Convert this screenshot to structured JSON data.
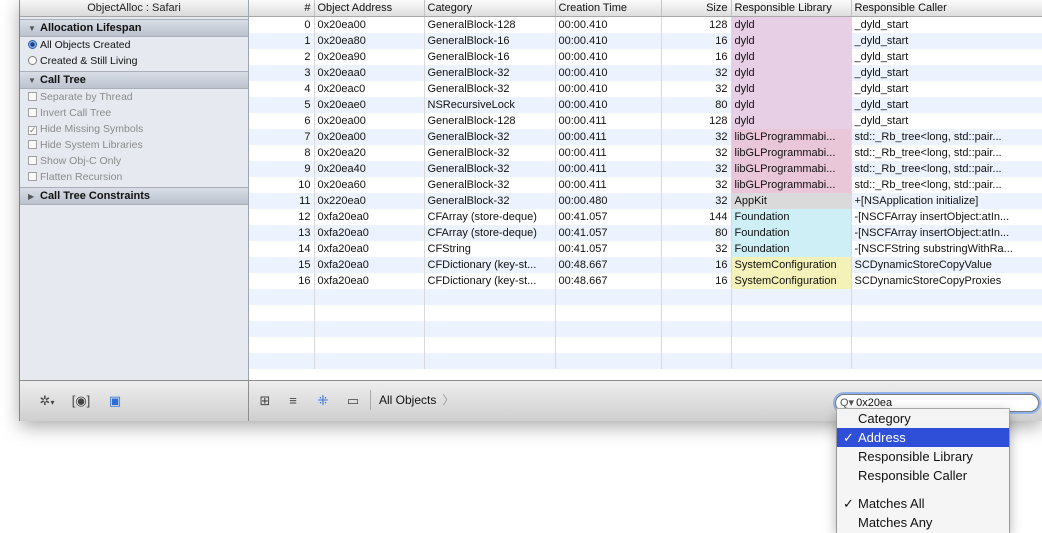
{
  "sidebar": {
    "title": "ObjectAlloc : Safari",
    "allocation": {
      "heading": "Allocation Lifespan",
      "options": [
        {
          "label": "All Objects Created",
          "selected": true
        },
        {
          "label": "Created & Still Living",
          "selected": false
        }
      ]
    },
    "calltree": {
      "heading": "Call Tree",
      "options": [
        {
          "label": "Separate by Thread",
          "checked": false
        },
        {
          "label": "Invert Call Tree",
          "checked": false
        },
        {
          "label": "Hide Missing Symbols",
          "checked": true
        },
        {
          "label": "Hide System Libraries",
          "checked": false
        },
        {
          "label": "Show Obj-C Only",
          "checked": false
        },
        {
          "label": "Flatten Recursion",
          "checked": false
        }
      ]
    },
    "constraints": {
      "heading": "Call Tree Constraints"
    }
  },
  "table": {
    "headers": [
      "#",
      "Object Address",
      "Category",
      "Creation Time",
      "Size",
      "Responsible Library",
      "Responsible Caller"
    ],
    "rows": [
      [
        "0",
        "0x20ea00",
        "GeneralBlock-128",
        "00:00.410",
        "128",
        "dyld",
        "_dyld_start"
      ],
      [
        "1",
        "0x20ea80",
        "GeneralBlock-16",
        "00:00.410",
        "16",
        "dyld",
        "_dyld_start"
      ],
      [
        "2",
        "0x20ea90",
        "GeneralBlock-16",
        "00:00.410",
        "16",
        "dyld",
        "_dyld_start"
      ],
      [
        "3",
        "0x20eaa0",
        "GeneralBlock-32",
        "00:00.410",
        "32",
        "dyld",
        "_dyld_start"
      ],
      [
        "4",
        "0x20eac0",
        "GeneralBlock-32",
        "00:00.410",
        "32",
        "dyld",
        "_dyld_start"
      ],
      [
        "5",
        "0x20eae0",
        "NSRecursiveLock",
        "00:00.410",
        "80",
        "dyld",
        "_dyld_start"
      ],
      [
        "6",
        "0x20ea00",
        "GeneralBlock-128",
        "00:00.411",
        "128",
        "dyld",
        "_dyld_start"
      ],
      [
        "7",
        "0x20ea00",
        "GeneralBlock-32",
        "00:00.411",
        "32",
        "libGLProgrammabi...",
        "std::_Rb_tree<long, std::pair..."
      ],
      [
        "8",
        "0x20ea20",
        "GeneralBlock-32",
        "00:00.411",
        "32",
        "libGLProgrammabi...",
        "std::_Rb_tree<long, std::pair..."
      ],
      [
        "9",
        "0x20ea40",
        "GeneralBlock-32",
        "00:00.411",
        "32",
        "libGLProgrammabi...",
        "std::_Rb_tree<long, std::pair..."
      ],
      [
        "10",
        "0x20ea60",
        "GeneralBlock-32",
        "00:00.411",
        "32",
        "libGLProgrammabi...",
        "std::_Rb_tree<long, std::pair..."
      ],
      [
        "11",
        "0x220ea0",
        "GeneralBlock-32",
        "00:00.480",
        "32",
        "AppKit",
        "+[NSApplication initialize]"
      ],
      [
        "12",
        "0xfa20ea0",
        "CFArray (store-deque)",
        "00:41.057",
        "144",
        "Foundation",
        "-[NSCFArray insertObject:atIn..."
      ],
      [
        "13",
        "0xfa20ea0",
        "CFArray (store-deque)",
        "00:41.057",
        "80",
        "Foundation",
        "-[NSCFArray insertObject:atIn..."
      ],
      [
        "14",
        "0xfa20ea0",
        "CFString",
        "00:41.057",
        "32",
        "Foundation",
        "-[NSCFString substringWithRa..."
      ],
      [
        "15",
        "0xfa20ea0",
        "CFDictionary (key-st...",
        "00:48.667",
        "16",
        "SystemConfiguration",
        "SCDynamicStoreCopyValue"
      ],
      [
        "16",
        "0xfa20ea0",
        "CFDictionary (key-st...",
        "00:48.667",
        "16",
        "SystemConfiguration",
        "SCDynamicStoreCopyProxies"
      ]
    ],
    "library_colors": {
      "dyld": "#e7cfe6",
      "libGLProgrammabi...": "#eac7d8",
      "AppKit": "#dadada",
      "Foundation": "#cdeff5",
      "SystemConfiguration": "#f4f2b9"
    }
  },
  "toolbar": {
    "left_icons": [
      "gear-icon",
      "eye-icon",
      "screen-icon"
    ],
    "view_icons": [
      "grid-view-icon",
      "list-view-icon",
      "tree-view-icon",
      "window-view-icon"
    ],
    "breadcrumb": "All Objects",
    "search_value": "0x20ea"
  },
  "search_menu": {
    "fields": [
      {
        "label": "Category",
        "checked": false
      },
      {
        "label": "Address",
        "checked": true
      },
      {
        "label": "Responsible Library",
        "checked": false
      },
      {
        "label": "Responsible Caller",
        "checked": false
      }
    ],
    "match": [
      {
        "label": "Matches All",
        "checked": true
      },
      {
        "label": "Matches Any",
        "checked": false
      }
    ]
  },
  "colors": {
    "selection": "#2f4fd9",
    "row_stripe": "#edf3fe"
  }
}
